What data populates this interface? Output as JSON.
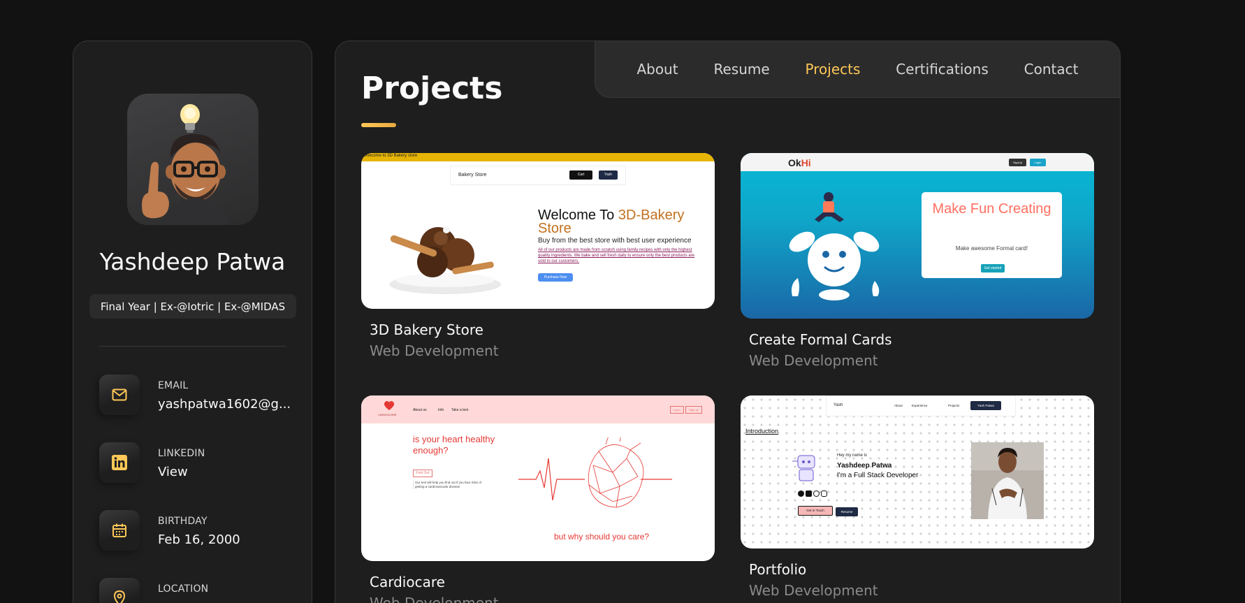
{
  "profile": {
    "name": "Yashdeep Patwa",
    "title": "Final Year | Ex-@Iotric | Ex-@MIDAS"
  },
  "contacts": [
    {
      "label": "Email",
      "value": "yashpatwa1602@g...",
      "icon": "mail-icon"
    },
    {
      "label": "Linkedin",
      "value": "View",
      "icon": "linkedin-icon"
    },
    {
      "label": "Birthday",
      "value": "Feb 16, 2000",
      "icon": "calendar-icon"
    },
    {
      "label": "Location",
      "value": "",
      "icon": "location-icon"
    }
  ],
  "nav": {
    "items": [
      "About",
      "Resume",
      "Projects",
      "Certifications",
      "Contact"
    ],
    "active": "Projects"
  },
  "page": {
    "title": "Projects"
  },
  "colors": {
    "accent": "#ffc857",
    "background": "#121212",
    "card": "#1e1e1f"
  },
  "projects": [
    {
      "title": "3D Bakery Store",
      "category": "Web Development",
      "preview": {
        "banner": "Welcome to 3D Bakery store",
        "brand": "Bakery Store",
        "cart": "Cart",
        "user": "Yash",
        "heading_prefix": "Welcome To ",
        "heading_highlight": "3D-Bakery Store",
        "subheading": "Buy from the best store with best user experience",
        "body": "All of our products are made from scratch using family recipes with only the highest quality ingredients. We bake and sell fresh daily to ensure only the best products are sold to our customers.",
        "cta": "Purchase Now"
      }
    },
    {
      "title": "Create Formal Cards",
      "category": "Web Development",
      "preview": {
        "logo_a": "Ok",
        "logo_b": "Hi",
        "signup": "SignUp",
        "login": "LogIn",
        "heading": "Make Fun Creating",
        "subheading": "Make awesome Formal card!",
        "cta": "Get started"
      }
    },
    {
      "title": "Cardiocare",
      "category": "Web Development",
      "preview": {
        "brand": "CARDIOCARE",
        "links": [
          "About us",
          "Info",
          "Take a test"
        ],
        "login": "Log in",
        "signup": "Sign up",
        "question": "is your heart healthy enough?",
        "find_out": "Find Out",
        "body": "Our test will help you find out if you face risks of getting a cardiovascular disease",
        "bottom": "but why should you care?"
      }
    },
    {
      "title": "Portfolio",
      "category": "Web Development",
      "preview": {
        "brand": "Yash",
        "links": [
          "About",
          "Experience",
          "Projects"
        ],
        "user": "Yash Patwa",
        "section": "Introduction",
        "greeting": "Hey my name is",
        "name": "Yashdeep Patwa",
        "role": "I'm a Full Stack Developer",
        "btn_touch": "Get In Touch",
        "btn_resume": "Resume"
      }
    }
  ]
}
